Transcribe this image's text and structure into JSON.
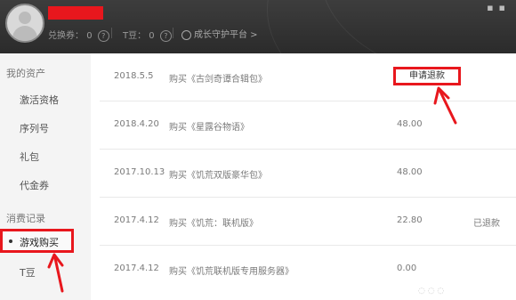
{
  "header": {
    "exchange_label": "兑换券：",
    "exchange_value": "0",
    "tbean_label": "T豆：",
    "tbean_value": "0",
    "guardian_link": "成长守护平台 >",
    "help_glyph": "?"
  },
  "sidebar": {
    "section_assets": "我的资产",
    "items_assets": [
      "激活资格",
      "序列号",
      "礼包",
      "代金券"
    ],
    "section_records": "消费记录",
    "active_item": "游戏购买",
    "items_records_after": [
      "T豆"
    ]
  },
  "purchases": [
    {
      "date": "2018.5.5",
      "desc": "购买《古剑奇谭合辑包》",
      "amount": "",
      "status": "",
      "action": "申请退款"
    },
    {
      "date": "2018.4.20",
      "desc": "购买《星露谷物语》",
      "amount": "48.00",
      "status": "",
      "action": ""
    },
    {
      "date": "2017.10.13",
      "desc": "购买《饥荒双版豪华包》",
      "amount": "48.00",
      "status": "",
      "action": ""
    },
    {
      "date": "2017.4.12",
      "desc": "购买《饥荒：联机版》",
      "amount": "22.80",
      "status": "已退款",
      "action": ""
    },
    {
      "date": "2017.4.12",
      "desc": "购买《饥荒联机版专用服务器》",
      "amount": "0.00",
      "status": "",
      "action": ""
    }
  ],
  "colors": {
    "highlight": "#e8171d",
    "header_bg": "#333333",
    "sidebar_bg": "#f4f4f4"
  }
}
